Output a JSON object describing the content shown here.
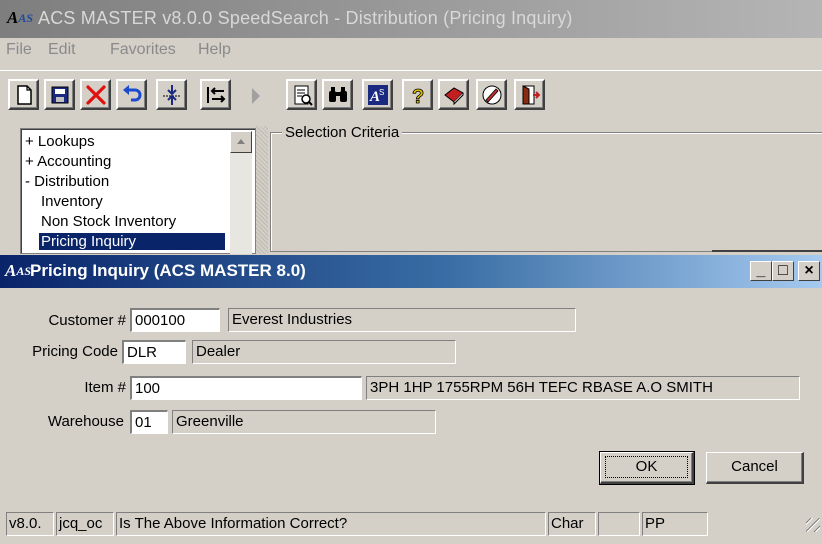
{
  "main_window": {
    "title": "ACS MASTER v8.0.0 SpeedSearch -  Distribution (Pricing Inquiry)",
    "logo_text": "AS"
  },
  "menu": [
    "File",
    "Edit",
    "Favorites",
    "Help"
  ],
  "toolbar": {
    "buttons": [
      "new-icon",
      "save-icon",
      "delete-icon",
      "undo-icon",
      "insert-icon",
      "swap-icon",
      "play-icon",
      "report-icon",
      "binoculars-icon",
      "acs-logo-icon",
      "help-icon",
      "notes-icon",
      "edit-icon",
      "exit-icon"
    ]
  },
  "tree": {
    "items": [
      "+ Lookups",
      "+ Accounting",
      "- Distribution",
      "Inventory",
      "Non Stock Inventory",
      "Pricing Inquiry"
    ],
    "selected": "Pricing Inquiry"
  },
  "selection_criteria": {
    "label": "Selection Criteria"
  },
  "dialog": {
    "title": "Pricing Inquiry (ACS MASTER 8.0)",
    "logo_text": "AS",
    "controls": {
      "minimize": "_",
      "maximize": "□",
      "close": "×"
    },
    "customer": {
      "label": "Customer #",
      "value": "000100",
      "name": "Everest Industries"
    },
    "pricing_code": {
      "label": "Pricing Code",
      "value": "DLR",
      "desc": "Dealer"
    },
    "item": {
      "label": "Item #",
      "value": "100",
      "desc": "3PH 1HP 1755RPM 56H TEFC RBASE A.O SMITH"
    },
    "warehouse": {
      "label": "Warehouse",
      "value": "01",
      "name": "Greenville"
    },
    "ok_label": "OK",
    "cancel_label": "Cancel"
  },
  "statusbar": {
    "version": "v8.0.",
    "user": "jcq_oc",
    "message": "Is The Above Information Correct?",
    "mode": "Char",
    "blank": "",
    "tag": "PP"
  },
  "colors": {
    "dialog_title_start": "#0a246a",
    "dialog_title_end": "#a6caf0",
    "selection": "#0a246a",
    "face": "#d4d0c8"
  }
}
